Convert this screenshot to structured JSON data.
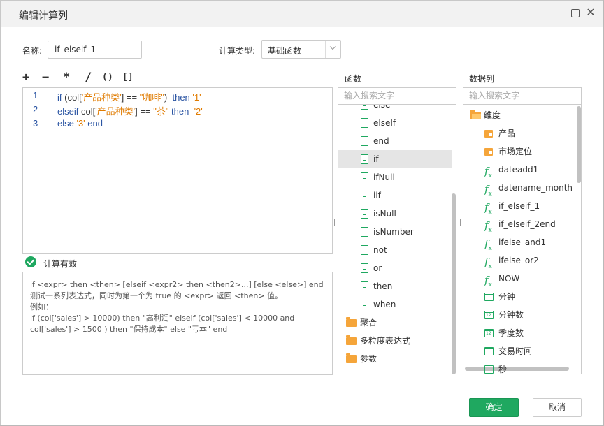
{
  "dialog": {
    "title": "编辑计算列"
  },
  "form": {
    "name_label": "名称:",
    "name_value": "if_elseif_1",
    "type_label": "计算类型:",
    "type_value": "基础函数"
  },
  "operators": [
    "+",
    "−",
    "*",
    "/",
    "()",
    "[]"
  ],
  "editor": {
    "lines": [
      {
        "num": "1",
        "tokens": [
          [
            "kw",
            "if "
          ],
          [
            "fn",
            "(col["
          ],
          [
            "str",
            "'产品种类'"
          ],
          [
            "fn",
            "] == "
          ],
          [
            "str",
            "\"咖啡\""
          ],
          [
            "fn",
            ")  "
          ],
          [
            "kw",
            "then "
          ],
          [
            "str",
            "'1'"
          ]
        ]
      },
      {
        "num": "2",
        "tokens": [
          [
            "kw",
            "elseif "
          ],
          [
            "fn",
            "col["
          ],
          [
            "str",
            "'产品种类'"
          ],
          [
            "fn",
            "] == "
          ],
          [
            "str",
            "\"茶\""
          ],
          [
            "kw",
            " then  "
          ],
          [
            "str",
            "'2'"
          ]
        ]
      },
      {
        "num": "3",
        "tokens": [
          [
            "kw",
            "else "
          ],
          [
            "str",
            "'3'"
          ],
          [
            "kw",
            " end"
          ]
        ]
      }
    ]
  },
  "validation": {
    "text": "计算有效"
  },
  "description": {
    "lines": [
      "if <expr> then <then> [elseif <expr2> then <then2>...] [else <else>] end",
      "测试一系列表达式，同时为第一个为 true 的 <expr> 返回 <then> 值。",
      "例如：",
      "if (col['sales'] > 10000) then \"高利润\" elseif (col['sales'] < 10000 and col['sales'] > 1500 ) then \"保持成本\" else \"亏本\" end"
    ]
  },
  "functions_panel": {
    "title": "函数",
    "search_placeholder": "输入搜索文字",
    "partial_item": "else",
    "items": [
      {
        "label": "elseIf",
        "icon": "function-doc-icon"
      },
      {
        "label": "end",
        "icon": "function-doc-icon"
      },
      {
        "label": "if",
        "icon": "function-doc-icon",
        "selected": true
      },
      {
        "label": "ifNull",
        "icon": "function-doc-icon"
      },
      {
        "label": "iif",
        "icon": "function-doc-icon"
      },
      {
        "label": "isNull",
        "icon": "function-doc-icon"
      },
      {
        "label": "isNumber",
        "icon": "function-doc-icon"
      },
      {
        "label": "not",
        "icon": "function-doc-icon"
      },
      {
        "label": "or",
        "icon": "function-doc-icon"
      },
      {
        "label": "then",
        "icon": "function-doc-icon"
      },
      {
        "label": "when",
        "icon": "function-doc-icon"
      }
    ],
    "folders": [
      {
        "label": "聚合",
        "icon": "folder-icon"
      },
      {
        "label": "多粒度表达式",
        "icon": "folder-icon"
      },
      {
        "label": "参数",
        "icon": "folder-icon"
      }
    ]
  },
  "columns_panel": {
    "title": "数据列",
    "search_placeholder": "输入搜索文字",
    "root": {
      "label": "维度",
      "icon": "folder-open-icon"
    },
    "items": [
      {
        "label": "产品",
        "icon": "dimension-icon"
      },
      {
        "label": "市场定位",
        "icon": "dimension-icon"
      },
      {
        "label": "dateadd1",
        "icon": "fx-icon"
      },
      {
        "label": "datename_month",
        "icon": "fx-icon"
      },
      {
        "label": "if_elseif_1",
        "icon": "fx-icon"
      },
      {
        "label": "if_elseif_2end",
        "icon": "fx-icon"
      },
      {
        "label": "ifelse_and1",
        "icon": "fx-icon"
      },
      {
        "label": "ifelse_or2",
        "icon": "fx-icon"
      },
      {
        "label": "NOW",
        "icon": "fx-icon"
      },
      {
        "label": "分钟",
        "icon": "calendar-icon"
      },
      {
        "label": "分钟数",
        "icon": "calendar-number-icon"
      },
      {
        "label": "季度数",
        "icon": "calendar-number-icon"
      },
      {
        "label": "交易时间",
        "icon": "calendar-icon"
      }
    ],
    "partial_item": "秒"
  },
  "footer": {
    "ok_label": "确定",
    "cancel_label": "取消"
  },
  "colors": {
    "accent_green": "#1fa860",
    "keyword_blue": "#2b55a3",
    "string_orange": "#e07b00",
    "folder_orange": "#f5a53a"
  }
}
